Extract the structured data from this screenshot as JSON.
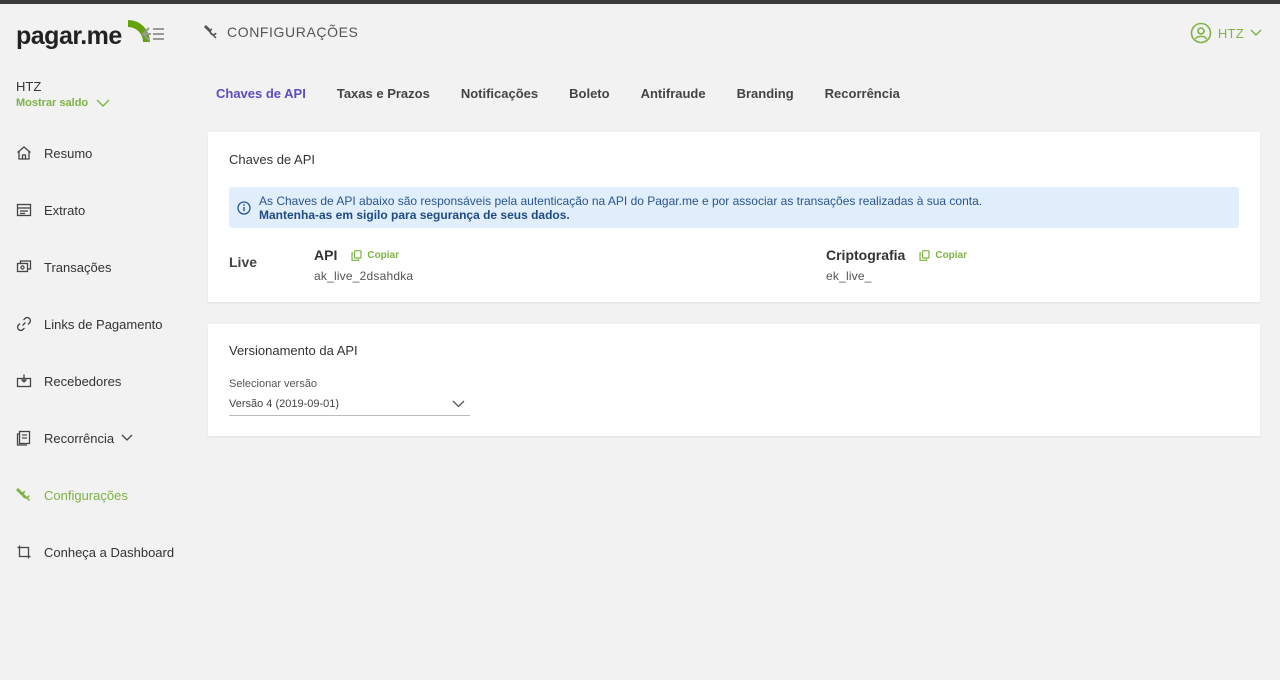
{
  "app": {
    "logo_text": "pagar.me",
    "page_title": "CONFIGURAÇÕES",
    "user_name": "HTZ",
    "accent_color": "#7cb342",
    "tab_active_color": "#5c4dc0"
  },
  "account": {
    "name": "HTZ",
    "balance_label": "Mostrar saldo"
  },
  "sidebar": {
    "items": [
      {
        "label": "Resumo",
        "icon": "home-icon"
      },
      {
        "label": "Extrato",
        "icon": "statement-icon"
      },
      {
        "label": "Transações",
        "icon": "transactions-icon"
      },
      {
        "label": "Links de Pagamento",
        "icon": "link-icon"
      },
      {
        "label": "Recebedores",
        "icon": "receivers-icon"
      },
      {
        "label": "Recorrência",
        "icon": "recurrence-icon"
      },
      {
        "label": "Configurações",
        "icon": "settings-icon",
        "active": true
      },
      {
        "label": "Conheça a Dashboard",
        "icon": "tour-icon"
      }
    ]
  },
  "tabs": [
    {
      "label": "Chaves de API",
      "active": true
    },
    {
      "label": "Taxas e Prazos"
    },
    {
      "label": "Notificações"
    },
    {
      "label": "Boleto"
    },
    {
      "label": "Antifraude"
    },
    {
      "label": "Branding"
    },
    {
      "label": "Recorrência"
    }
  ],
  "api_keys": {
    "title": "Chaves de API",
    "info_text": "As Chaves de API abaixo são responsáveis pela autenticação na API do Pagar.me e por associar as transações realizadas à sua conta.",
    "info_bold": "Mantenha-as em sigilo para segurança de seus dados.",
    "environment": "Live",
    "api_label": "API",
    "api_value": "ak_live_2dsahdka",
    "crypto_label": "Criptografia",
    "crypto_value": "ek_live_",
    "copy_label": "Copiar"
  },
  "versioning": {
    "title": "Versionamento da API",
    "select_label": "Selecionar versão",
    "selected_value": "Versão 4 (2019-09-01)"
  }
}
